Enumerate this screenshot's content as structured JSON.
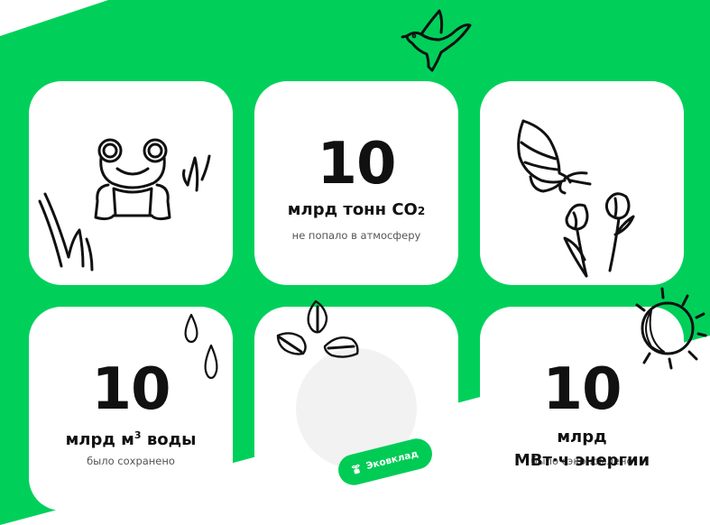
{
  "colors": {
    "accent": "#00d05a",
    "card": "#ffffff",
    "text": "#111111",
    "muted": "#555555"
  },
  "cards": [
    {
      "type": "illustration",
      "icon": "frog-with-grass-icon"
    },
    {
      "type": "stat",
      "value": "10",
      "unit_main": "млрд тонн CO",
      "unit_sub": "2",
      "caption": "не попало в атмосферу"
    },
    {
      "type": "illustration",
      "icon": "butterfly-on-flowers-icon"
    },
    {
      "type": "stat",
      "value": "10",
      "unit_main": "млрд м",
      "unit_sup": "3",
      "unit_tail": " воды",
      "caption": "было сохранено"
    },
    {
      "type": "badge",
      "badge_label": "Эковклад",
      "badge_icon": "sprout-pot-icon"
    },
    {
      "type": "stat",
      "value": "10",
      "unit_line1": "млрд",
      "unit_line2": "МВт·ч энергии",
      "caption": "было сэкономлено"
    }
  ],
  "decorations": [
    "dove-icon",
    "water-drops-icon",
    "leaves-icon",
    "sun-icon"
  ]
}
